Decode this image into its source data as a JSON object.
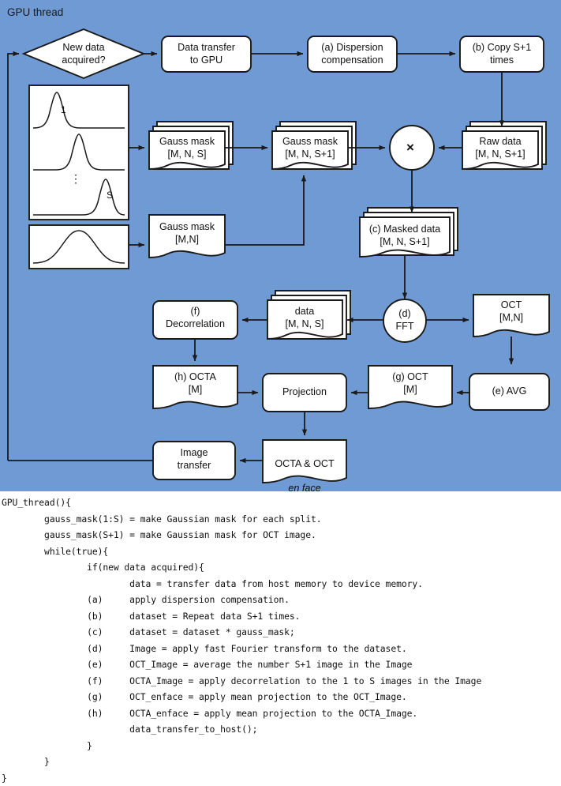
{
  "panel": {
    "title": "GPU thread",
    "background_color": "#6F9AD4",
    "shape_fill": "#FFFFFF",
    "stroke_color": "#1A1A1A"
  },
  "nodes": {
    "decision": "New data\nacquired?",
    "data_transfer": "Data transfer\nto GPU",
    "dispersion": "(a) Dispersion\ncompensation",
    "copy": "(b) Copy S+1\ntimes",
    "gauss_mask_s": "Gauss mask\n[M, N, S]",
    "gauss_mask_s1": "Gauss mask\n[M, N, S+1]",
    "gauss_mask_mn": "Gauss mask\n[M,N]",
    "raw_data": "Raw data\n[M, N, S+1]",
    "masked_data": "(c) Masked data\n[M, N, S+1]",
    "multiply_symbol": "×",
    "fft": "(d)\nFFT",
    "data_mns": "data\n[M, N, S]",
    "decorrelation": "(f)\nDecorrelation",
    "oct_mn": "OCT\n[M,N]",
    "octa_m": "(h) OCTA\n[M]",
    "projection": "Projection",
    "oct_m": "(g) OCT\n[M]",
    "avg": "(e) AVG",
    "image_transfer": "Image\ntransfer",
    "en_face_line1": "OCTA & OCT",
    "en_face_line2": "en face"
  },
  "plot_labels": {
    "split_first": "1",
    "split_last": "S",
    "ellipsis": "⋮"
  },
  "code": {
    "lines": [
      "GPU_thread(){",
      "        gauss_mask(1:S) = make Gaussian mask for each split.",
      "        gauss_mask(S+1) = make Gaussian mask for OCT image.",
      "        while(true){",
      "                if(new data acquired){",
      "                        data = transfer data from host memory to device memory.",
      "                (a)     apply dispersion compensation.",
      "                (b)     dataset = Repeat data S+1 times.",
      "                (c)     dataset = dataset * gauss_mask;",
      "                (d)     Image = apply fast Fourier transform to the dataset.",
      "                (e)     OCT_Image = average the number S+1 image in the Image",
      "                (f)     OCTA_Image = apply decorrelation to the 1 to S images in the Image",
      "                (g)     OCT_enface = apply mean projection to the OCT_Image.",
      "                (h)     OCTA_enface = apply mean projection to the OCTA_Image.",
      "                        data_transfer_to_host();",
      "                }",
      "        }",
      "}"
    ]
  }
}
